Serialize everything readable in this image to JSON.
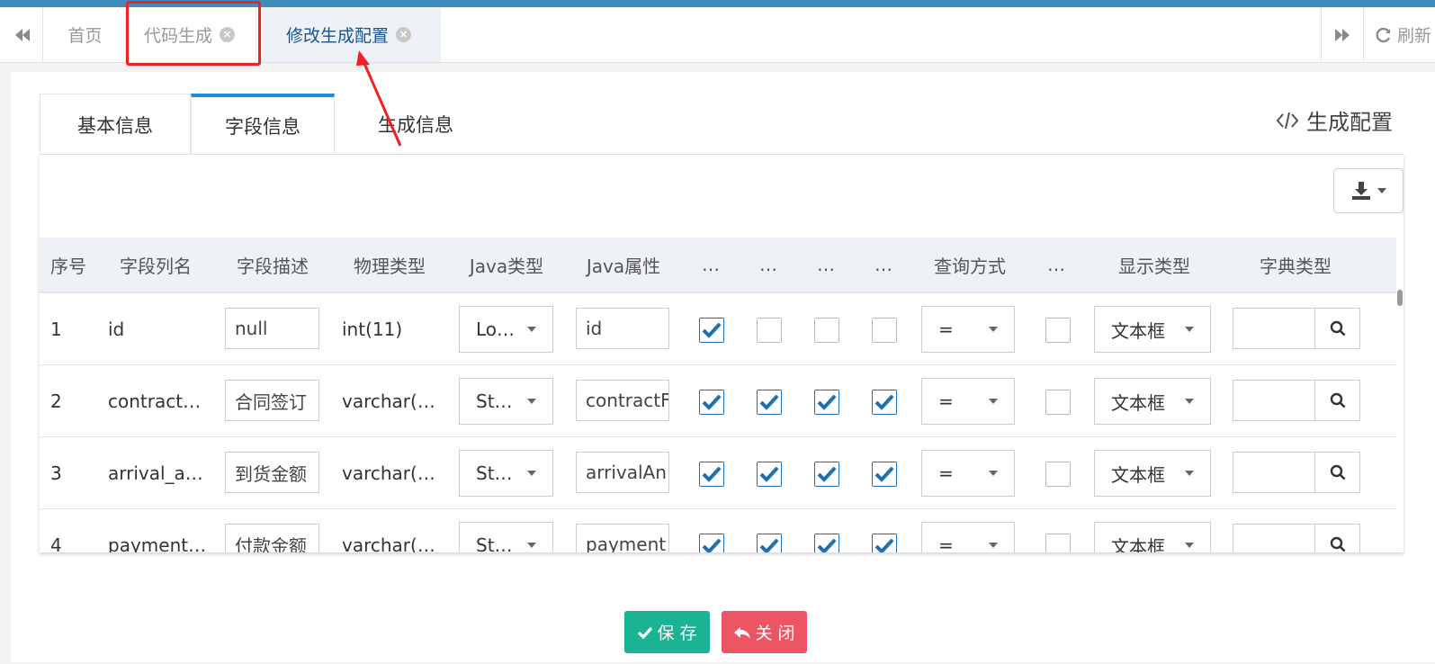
{
  "tabbar": {
    "home": "首页",
    "codegen": "代码生成",
    "active": "修改生成配置",
    "refresh": "刷新"
  },
  "subtabs": [
    "基本信息",
    "字段信息",
    "生成信息"
  ],
  "gen_config_label": "生成配置",
  "columns": [
    "序号",
    "字段列名",
    "字段描述",
    "物理类型",
    "Java类型",
    "Java属性",
    "…",
    "…",
    "…",
    "…",
    "查询方式",
    "…",
    "显示类型",
    "字典类型"
  ],
  "rows": [
    {
      "no": "1",
      "col": "id",
      "desc": "null",
      "phys": "int(11)",
      "jtype": "Lo…",
      "jprop": "id",
      "checks": [
        true,
        false,
        false,
        false
      ],
      "query": "=",
      "req": false,
      "display": "文本框"
    },
    {
      "no": "2",
      "col": "contract…",
      "desc": "合同签订",
      "phys": "varchar(…",
      "jtype": "St…",
      "jprop": "contractF",
      "checks": [
        true,
        true,
        true,
        true
      ],
      "query": "=",
      "req": false,
      "display": "文本框"
    },
    {
      "no": "3",
      "col": "arrival_a…",
      "desc": "到货金额",
      "phys": "varchar(…",
      "jtype": "St…",
      "jprop": "arrivalAn",
      "checks": [
        true,
        true,
        true,
        true
      ],
      "query": "=",
      "req": false,
      "display": "文本框"
    },
    {
      "no": "4",
      "col": "payment…",
      "desc": "付款金额",
      "phys": "varchar(…",
      "jtype": "St…",
      "jprop": "payment",
      "checks": [
        true,
        true,
        true,
        true
      ],
      "query": "=",
      "req": false,
      "display": "文本框"
    }
  ],
  "buttons": {
    "save": "保 存",
    "close": "关 闭"
  },
  "colors": {
    "accent": "#1e88e5",
    "save": "#1ab394",
    "close": "#ed5565",
    "highlight": "#ee2222"
  },
  "icons": [
    "backward-icon",
    "close-circle-icon",
    "forward-icon",
    "refresh-icon",
    "code-icon",
    "download-icon",
    "caret-down-icon",
    "search-icon",
    "check-icon",
    "reply-icon"
  ]
}
